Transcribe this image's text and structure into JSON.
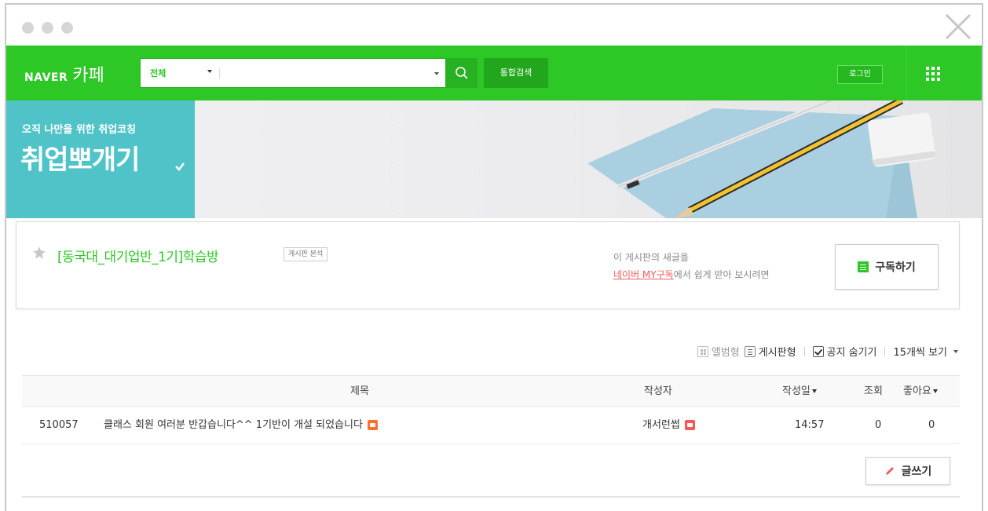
{
  "window": {
    "close_icon": "close-icon"
  },
  "nav": {
    "logo_naver": "NAVER",
    "logo_cafe": "카페",
    "search_scope": "전체",
    "search_placeholder": "",
    "search_icon": "search-icon",
    "integrated_search_label": "통합검색",
    "login_label": "로그인",
    "apps_icon": "grid-icon",
    "brand_color": "#2dc826"
  },
  "banner": {
    "subtitle": "오직 나만을 위한 취업코칭",
    "title": "취업뽀개기",
    "accent_color": "#4fc3c8"
  },
  "board": {
    "title": "[동국대_대기업반_1기]학습방",
    "tag_label": "게시판 분석",
    "subscribe_line1": "이 게시판의 새글을",
    "subscribe_link": "네이버 MY구독",
    "subscribe_line2_rest": "에서 쉽게 받아 보시려면",
    "subscribe_button": "구독하기"
  },
  "view_options": {
    "album_label": "앨범형",
    "board_label": "게시판형",
    "hide_notice_label": "공지 숨기기",
    "per_page_label": "15개씩 보기"
  },
  "table": {
    "headers": {
      "title": "제목",
      "author": "작성자",
      "date": "작성일",
      "views": "조회",
      "likes": "좋아요"
    },
    "rows": [
      {
        "num": "510057",
        "title": "클래스 회원 여러분 반갑습니다^^ 1기반이 개설 되었습니다",
        "author": "개서런썹",
        "date": "14:57",
        "views": "0",
        "likes": "0"
      }
    ]
  },
  "write_button": "글쓰기"
}
